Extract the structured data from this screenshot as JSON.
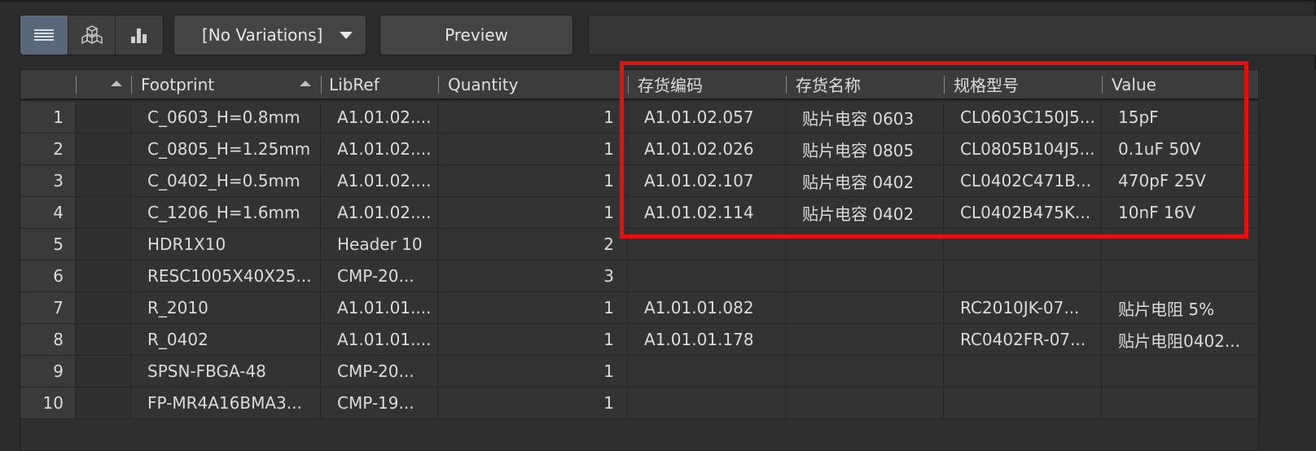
{
  "toolbar": {
    "view_buttons": [
      {
        "icon": "list-view-icon",
        "active": true
      },
      {
        "icon": "3d-view-icon",
        "active": false
      },
      {
        "icon": "bar-chart-icon",
        "active": false
      }
    ],
    "variation_select": "[No Variations]",
    "preview_label": "Preview"
  },
  "grid": {
    "columns": [
      "",
      "",
      "Footprint",
      "LibRef",
      "Quantity",
      "存货编码",
      "存货名称",
      "规格型号",
      "Value"
    ],
    "rows": [
      {
        "num": "1",
        "footprint": "C_0603_H=0.8mm",
        "libref": "A1.01.02....",
        "qty": "1",
        "code": "A1.01.02.057",
        "name": "贴片电容 0603",
        "spec": "CL0603C150J5...",
        "value": "15pF"
      },
      {
        "num": "2",
        "footprint": "C_0805_H=1.25mm",
        "libref": "A1.01.02....",
        "qty": "1",
        "code": "A1.01.02.026",
        "name": "贴片电容 0805",
        "spec": "CL0805B104J5...",
        "value": "0.1uF 50V"
      },
      {
        "num": "3",
        "footprint": "C_0402_H=0.5mm",
        "libref": "A1.01.02....",
        "qty": "1",
        "code": "A1.01.02.107",
        "name": "贴片电容 0402",
        "spec": "CL0402C471B...",
        "value": "470pF 25V"
      },
      {
        "num": "4",
        "footprint": "C_1206_H=1.6mm",
        "libref": "A1.01.02....",
        "qty": "1",
        "code": "A1.01.02.114",
        "name": "贴片电容 0402",
        "spec": "CL0402B475K...",
        "value": "10nF 16V"
      },
      {
        "num": "5",
        "footprint": "HDR1X10",
        "libref": "Header 10",
        "qty": "2",
        "code": "",
        "name": "",
        "spec": "",
        "value": ""
      },
      {
        "num": "6",
        "footprint": "RESC1005X40X25...",
        "libref": "CMP-20...",
        "qty": "3",
        "code": "",
        "name": "",
        "spec": "",
        "value": ""
      },
      {
        "num": "7",
        "footprint": "R_2010",
        "libref": "A1.01.01....",
        "qty": "1",
        "code": "A1.01.01.082",
        "name": "",
        "spec": "RC2010JK-07...",
        "value": "贴片电阻 5%"
      },
      {
        "num": "8",
        "footprint": "R_0402",
        "libref": "A1.01.01....",
        "qty": "1",
        "code": "A1.01.01.178",
        "name": "",
        "spec": "RC0402FR-07...",
        "value": "贴片电阻0402..."
      },
      {
        "num": "9",
        "footprint": "SPSN-FBGA-48",
        "libref": "CMP-20...",
        "qty": "1",
        "code": "",
        "name": "",
        "spec": "",
        "value": ""
      },
      {
        "num": "10",
        "footprint": "FP-MR4A16BMA3...",
        "libref": "CMP-19...",
        "qty": "1",
        "code": "",
        "name": "",
        "spec": "",
        "value": ""
      }
    ]
  },
  "colors": {
    "highlight_border": "#e1120f",
    "active_view": "#5a6778",
    "background": "#2b2b2b"
  }
}
